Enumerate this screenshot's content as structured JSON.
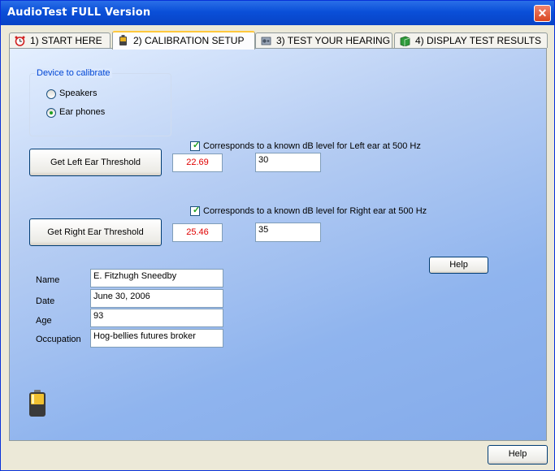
{
  "window": {
    "title": "AudioTest FULL Version",
    "close_glyph": "✕"
  },
  "tabs": [
    {
      "label": "1) START HERE",
      "icon": "alarm-clock-icon"
    },
    {
      "label": "2) CALIBRATION SETUP",
      "icon": "battery-icon"
    },
    {
      "label": "3) TEST YOUR HEARING",
      "icon": "speaker-icon"
    },
    {
      "label": "4) DISPLAY TEST RESULTS",
      "icon": "book-icon"
    }
  ],
  "active_tab": 1,
  "calibration": {
    "device_group_title": "Device to calibrate",
    "devices": [
      {
        "label": "Speakers",
        "selected": false
      },
      {
        "label": "Ear phones",
        "selected": true
      }
    ],
    "left": {
      "button_label": "Get Left Ear Threshold",
      "measured_value": "22.69",
      "known_checked": true,
      "known_label": "Corresponds to a known dB level for Left ear at 500 Hz",
      "known_db": "30"
    },
    "right": {
      "button_label": "Get Right Ear Threshold",
      "measured_value": "25.46",
      "known_checked": true,
      "known_label": "Corresponds to a known dB level for Right ear at 500 Hz",
      "known_db": "35"
    },
    "help_label": "Help"
  },
  "person": {
    "name_label": "Name",
    "name": "E. Fitzhugh Sneedby",
    "date_label": "Date",
    "date": "June 30, 2006",
    "age_label": "Age",
    "age": "93",
    "occupation_label": "Occupation",
    "occupation": "Hog-bellies futures broker"
  },
  "footer": {
    "help_label": "Help"
  },
  "colors": {
    "measured_text": "#e00000",
    "titlebar": "#0a4fd8",
    "accent_green": "#21a121"
  }
}
